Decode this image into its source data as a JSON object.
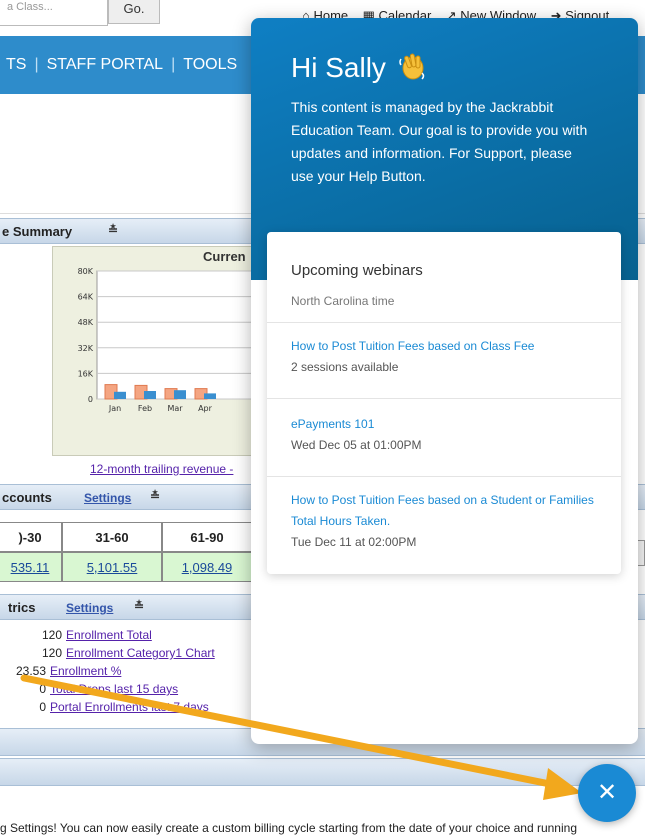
{
  "topbar": {
    "search_placeholder": "a Class...",
    "go_label": "Go.",
    "links": [
      "Home",
      "Calendar",
      "New Window",
      "Signout"
    ]
  },
  "navbar": {
    "items": [
      "TS",
      "STAFF PORTAL",
      "TOOLS"
    ]
  },
  "revenue_section": {
    "title": "e Summary",
    "chart_title": "Curren",
    "link": "12-month trailing revenue -"
  },
  "chart_data": {
    "type": "bar",
    "categories": [
      "Jan",
      "Feb",
      "Mar",
      "Apr"
    ],
    "ylim": [
      0,
      80000
    ],
    "y_ticks": [
      "0",
      "16K",
      "32K",
      "48K",
      "64K",
      "80K"
    ],
    "series": [
      {
        "values": [
          9000,
          8500,
          6500,
          6500
        ],
        "color": "#f4a582"
      },
      {
        "values": [
          4500,
          5000,
          5500,
          3500
        ],
        "color": "#3a8fd0"
      }
    ]
  },
  "accounts_section": {
    "title": "ccounts",
    "settings": "Settings",
    "headers": [
      ")-30",
      "31-60",
      "61-90"
    ],
    "values": [
      "535.11",
      "5,101.55",
      "1,098.49"
    ]
  },
  "metrics_section": {
    "title": "trics",
    "settings": "Settings",
    "rows": [
      {
        "num": "120",
        "label": "Enrollment Total"
      },
      {
        "num": "120",
        "label": "Enrollment Category1 Chart"
      },
      {
        "num": "23.53",
        "label": "Enrollment %"
      },
      {
        "num": "0",
        "label": "Total Drops last 15 days"
      },
      {
        "num": "0",
        "label": "Portal Enrollments last 7 days"
      }
    ]
  },
  "bottom_message": "g Settings! You can now easily create a custom billing cycle starting from the date of your choice and running",
  "messenger": {
    "greeting": "Hi Sally",
    "intro": "This content is managed by the Jackrabbit Education Team. Our goal is to provide you with updates and information. For Support, please use your Help Button.",
    "card_title": "Upcoming webinars",
    "card_subtitle": "North Carolina time",
    "webinars": [
      {
        "title": "How to Post Tuition Fees based on Class Fee",
        "meta": "2 sessions available"
      },
      {
        "title": "ePayments 101",
        "meta": "Wed Dec 05 at 01:00PM"
      },
      {
        "title": "How to Post Tuition Fees based on a Student or Families Total Hours Taken.",
        "meta": "Tue Dec 11 at 02:00PM"
      }
    ]
  },
  "colors": {
    "nav_blue": "#2e8ccb",
    "messenger_blue": "#0f7fc4",
    "link_blue": "#1a8ad4",
    "arrow_gold": "#f2a81d"
  }
}
